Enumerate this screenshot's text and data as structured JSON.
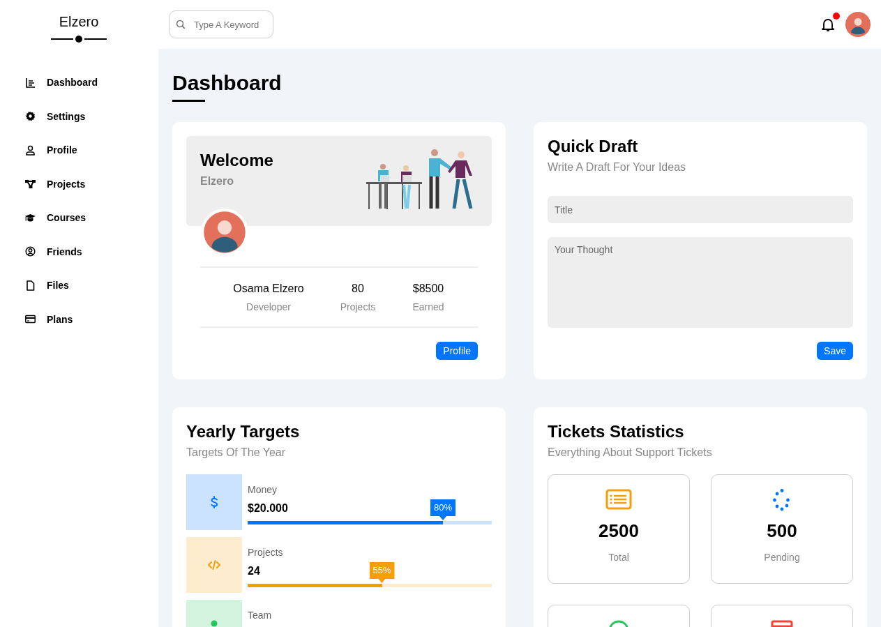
{
  "brand": {
    "name": "Elzero"
  },
  "search": {
    "placeholder": "Type A Keyword"
  },
  "notifications": {
    "unread": true
  },
  "sidebar": {
    "items": [
      {
        "label": "Dashboard"
      },
      {
        "label": "Settings"
      },
      {
        "label": "Profile"
      },
      {
        "label": "Projects"
      },
      {
        "label": "Courses"
      },
      {
        "label": "Friends"
      },
      {
        "label": "Files"
      },
      {
        "label": "Plans"
      }
    ]
  },
  "page_title": "Dashboard",
  "welcome": {
    "title": "Welcome",
    "subtitle": "Elzero",
    "stats": [
      {
        "value": "Osama Elzero",
        "label": "Developer"
      },
      {
        "value": "80",
        "label": "Projects"
      },
      {
        "value": "$8500",
        "label": "Earned"
      }
    ],
    "button": "Profile"
  },
  "quick_draft": {
    "title": "Quick Draft",
    "subtitle": "Write A Draft For Your Ideas",
    "title_placeholder": "Title",
    "thought_placeholder": "Your Thought",
    "button": "Save"
  },
  "yearly_targets": {
    "title": "Yearly Targets",
    "subtitle": "Targets Of The Year",
    "targets": [
      {
        "kind": "money",
        "label": "Money",
        "value": "$20.000",
        "level": 0.8,
        "percent": "80%",
        "color": "#0075ff"
      },
      {
        "kind": "projects",
        "label": "Projects",
        "value": "24",
        "level": 0.55,
        "percent": "55%",
        "color": "#f59e0b"
      },
      {
        "kind": "team",
        "label": "Team",
        "color": "#22c55e"
      }
    ]
  },
  "tickets": {
    "title": "Tickets Statistics",
    "subtitle": "Everything About Support Tickets",
    "cards": [
      {
        "kind": "total",
        "value": "2500",
        "label": "Total",
        "color": "#f59e0b"
      },
      {
        "kind": "pending",
        "value": "500",
        "label": "Pending",
        "color": "#0075ff"
      },
      {
        "kind": "closed",
        "color": "#22c55e"
      },
      {
        "kind": "deleted",
        "color": "#f44336"
      }
    ]
  }
}
